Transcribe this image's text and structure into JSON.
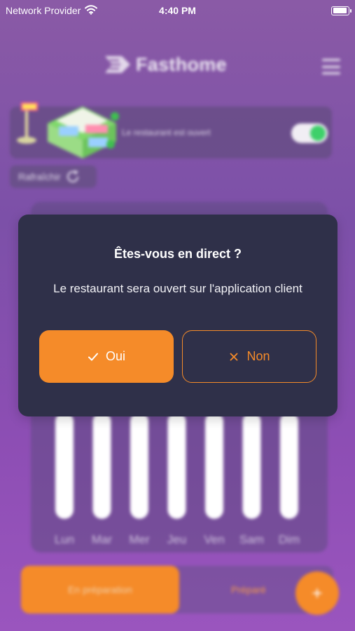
{
  "status_bar": {
    "carrier": "Network Provider",
    "time": "4:40 PM",
    "battery_level": 0.95
  },
  "header": {
    "brand_name": "Fasthome",
    "icons": {
      "logo": "arrow-logo-icon",
      "menu": "hamburger-menu-icon"
    }
  },
  "restaurant_status": {
    "label": "Le restaurant est ouvert",
    "is_open": true,
    "toggle_color": "#3ed06a"
  },
  "refresh": {
    "label": "Rafraîchir",
    "icon": "refresh-icon"
  },
  "chart_data": {
    "type": "bar",
    "categories": [
      "Lun",
      "Mar",
      "Mer",
      "Jeu",
      "Ven",
      "Sam",
      "Dim"
    ],
    "values": [
      0,
      0,
      0,
      0,
      0,
      0,
      0
    ],
    "title": "",
    "xlabel": "",
    "ylabel": "",
    "grid": false
  },
  "orders_tabs": {
    "active": "En préparation",
    "inactive": "Préparé"
  },
  "fab": {
    "label": "+",
    "icon": "plus-icon"
  },
  "dialog": {
    "title": "Êtes-vous en direct ?",
    "message": "Le restaurant sera ouvert sur l'application client",
    "confirm_label": "Oui",
    "cancel_label": "Non",
    "confirm_icon": "check-icon",
    "cancel_icon": "close-icon"
  },
  "colors": {
    "accent": "#f58b29",
    "dialog_bg": "#2f3049",
    "background_top": "#8a5aa6",
    "background_bottom": "#9a55be"
  }
}
